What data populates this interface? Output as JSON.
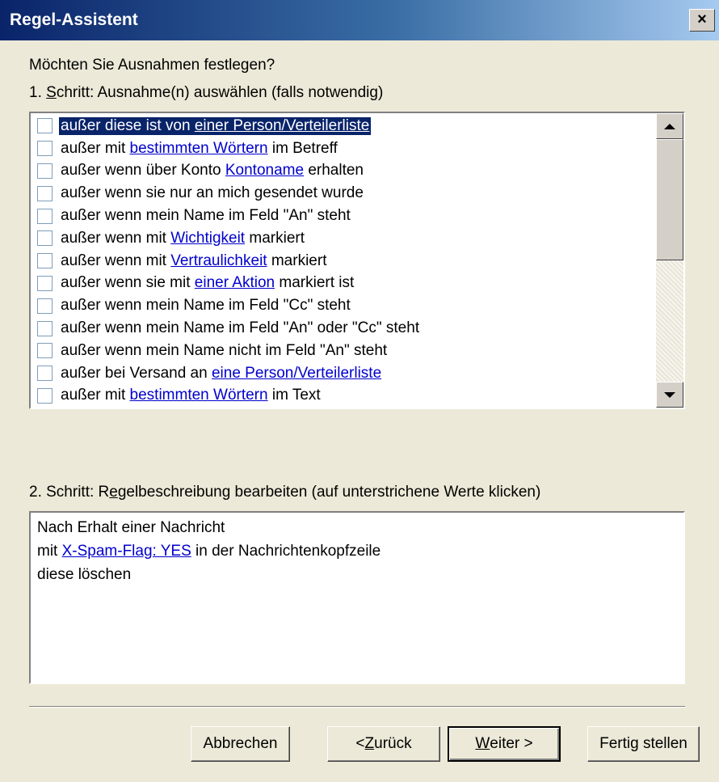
{
  "window": {
    "title": "Regel-Assistent",
    "close_label": "×"
  },
  "prompt": "Möchten Sie Ausnahmen festlegen?",
  "step1": {
    "prefix": "1. ",
    "accel": "S",
    "rest": "chritt: Ausnahme(n) auswählen (falls notwendig)"
  },
  "exceptions": [
    {
      "checked": false,
      "selected": true,
      "before": "außer diese ist von ",
      "link": "einer Person/Verteilerliste",
      "after": ""
    },
    {
      "checked": false,
      "selected": false,
      "before": "außer mit ",
      "link": "bestimmten Wörtern",
      "after": " im Betreff"
    },
    {
      "checked": false,
      "selected": false,
      "before": "außer wenn über Konto ",
      "link": "Kontoname",
      "after": " erhalten"
    },
    {
      "checked": false,
      "selected": false,
      "before": "außer wenn sie nur an mich gesendet wurde",
      "link": "",
      "after": ""
    },
    {
      "checked": false,
      "selected": false,
      "before": "außer wenn mein Name im Feld \"An\" steht",
      "link": "",
      "after": ""
    },
    {
      "checked": false,
      "selected": false,
      "before": "außer wenn mit ",
      "link": "Wichtigkeit",
      "after": " markiert"
    },
    {
      "checked": false,
      "selected": false,
      "before": "außer wenn mit ",
      "link": "Vertraulichkeit",
      "after": " markiert"
    },
    {
      "checked": false,
      "selected": false,
      "before": "außer wenn sie mit ",
      "link": "einer Aktion",
      "after": " markiert ist"
    },
    {
      "checked": false,
      "selected": false,
      "before": "außer wenn mein Name im Feld \"Cc\" steht",
      "link": "",
      "after": ""
    },
    {
      "checked": false,
      "selected": false,
      "before": "außer wenn mein Name im Feld \"An\" oder \"Cc\" steht",
      "link": "",
      "after": ""
    },
    {
      "checked": false,
      "selected": false,
      "before": "außer wenn mein Name nicht im Feld \"An\" steht",
      "link": "",
      "after": ""
    },
    {
      "checked": false,
      "selected": false,
      "before": "außer bei Versand an ",
      "link": "eine Person/Verteilerliste",
      "after": ""
    },
    {
      "checked": false,
      "selected": false,
      "before": "außer mit ",
      "link": "bestimmten Wörtern",
      "after": " im Text"
    }
  ],
  "step2": {
    "prefix": "2. Schritt: R",
    "accel": "e",
    "rest": "gelbeschreibung bearbeiten (auf unterstrichene Werte klicken)"
  },
  "description": {
    "line1": "Nach Erhalt einer Nachricht",
    "line2_before": "mit ",
    "line2_link": "X-Spam-Flag: YES",
    "line2_after": " in der Nachrichtenkopfzeile",
    "line3": "diese löschen"
  },
  "buttons": {
    "cancel": "Abbrechen",
    "back_pre": "< ",
    "back_accel": "Z",
    "back_rest": "urück",
    "next_accel": "W",
    "next_rest": "eiter >",
    "finish": "Fertig stellen"
  }
}
